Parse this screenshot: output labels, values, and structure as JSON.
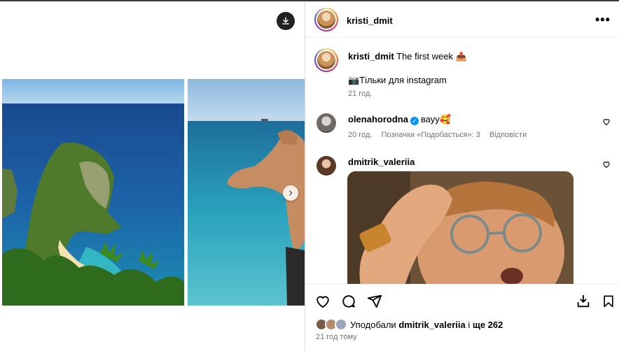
{
  "post": {
    "author": "kristi_dmit",
    "caption_user": "kristi_dmit",
    "caption_text": "The first week 📤",
    "caption_line2": "📷Тільки для instagram",
    "caption_time": "21 год."
  },
  "comments": [
    {
      "user": "olenahorodna",
      "text": "вауу🥰",
      "time": "20 год.",
      "likes_label": "Позначки «Подобається»: 3",
      "reply_label": "Відповісти"
    },
    {
      "user": "dmitrik_valeriia"
    }
  ],
  "likes": {
    "prefix": "Уподобали",
    "user": "dmitrik_valeriia",
    "middle": "і",
    "count_text": "ще 262"
  },
  "post_time": "21 год тому",
  "icons": {
    "download": "download-icon",
    "more": "more-options-icon",
    "next": "chevron-right-icon",
    "like": "heart-icon",
    "comment": "comment-icon",
    "share": "share-icon",
    "save_media": "save-media-icon",
    "bookmark": "bookmark-icon"
  },
  "colors": {
    "verified": "#0095f6",
    "meta_text": "#737373",
    "border": "#dbdbdb"
  }
}
